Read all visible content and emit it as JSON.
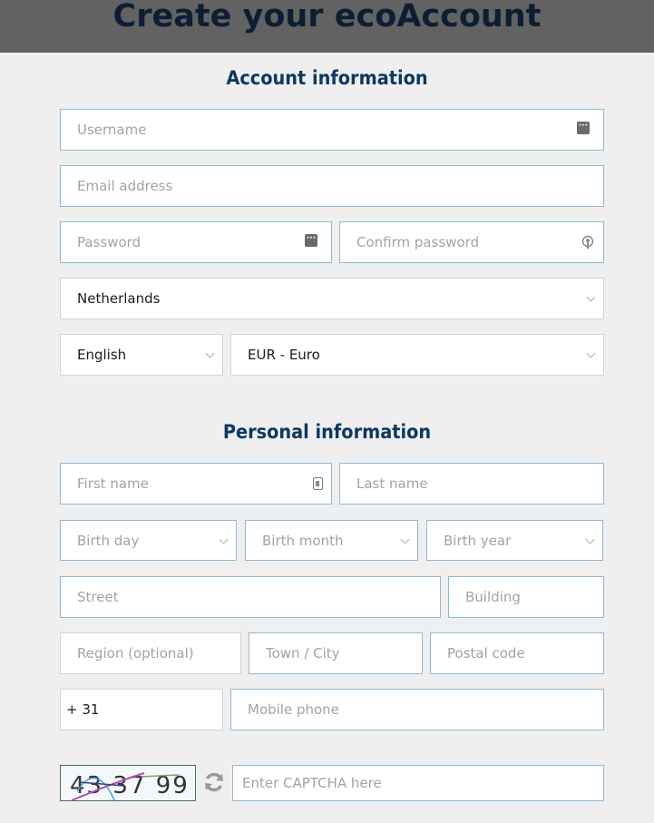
{
  "header": {
    "title": "Create your ecoAccount"
  },
  "account_section": {
    "title": "Account information",
    "username": {
      "placeholder": "Username",
      "value": ""
    },
    "email": {
      "placeholder": "Email address",
      "value": ""
    },
    "password": {
      "placeholder": "Password",
      "value": ""
    },
    "confirm_password": {
      "placeholder": "Confirm password",
      "value": ""
    },
    "country": {
      "selected": "Netherlands"
    },
    "language": {
      "selected": "English"
    },
    "currency": {
      "selected": "EUR - Euro"
    }
  },
  "personal_section": {
    "title": "Personal information",
    "first_name": {
      "placeholder": "First name",
      "value": ""
    },
    "last_name": {
      "placeholder": "Last name",
      "value": ""
    },
    "birth_day": {
      "placeholder": "Birth day"
    },
    "birth_month": {
      "placeholder": "Birth month"
    },
    "birth_year": {
      "placeholder": "Birth year"
    },
    "street": {
      "placeholder": "Street",
      "value": ""
    },
    "building": {
      "placeholder": "Building",
      "value": ""
    },
    "region": {
      "placeholder": "Region (optional)",
      "value": ""
    },
    "town": {
      "placeholder": "Town / City",
      "value": ""
    },
    "postal_code": {
      "placeholder": "Postal code",
      "value": ""
    },
    "phone_prefix": {
      "value": "+ 31"
    },
    "mobile_phone": {
      "placeholder": "Mobile phone",
      "value": ""
    }
  },
  "captcha": {
    "image_text": "43 37 99",
    "input": {
      "placeholder": "Enter CAPTCHA here",
      "value": ""
    },
    "icons": {
      "refresh": "refresh-icon"
    }
  },
  "colors": {
    "header_bg": "#626262",
    "title_color": "#0d1e33",
    "section_title_color": "#0d3860",
    "field_border": "#8fb8d6",
    "chevron": "#8dc07a",
    "page_bg": "#efefef"
  }
}
